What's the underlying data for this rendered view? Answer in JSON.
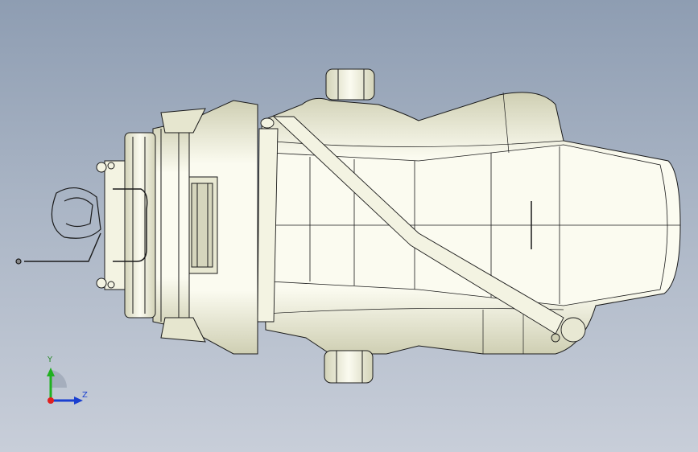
{
  "viewport": {
    "background_top": "#8e9db2",
    "background_bottom": "#c8ced9",
    "model_fill": "#fbfbf0",
    "model_shade": "#d9d9c0",
    "edge_color": "#1a1a1a"
  },
  "triad": {
    "y_label": "Y",
    "z_label": "Z",
    "y_color": "#20b020",
    "z_color": "#1a3fd0",
    "x_color": "#e02020"
  }
}
